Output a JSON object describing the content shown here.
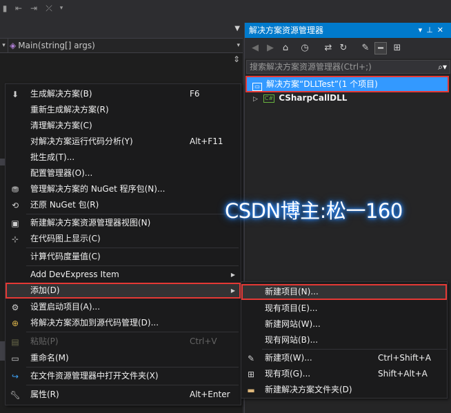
{
  "editor": {
    "nav_method": "Main(string[] args)"
  },
  "solution_explorer": {
    "title": "解决方案资源管理器",
    "title_buttons": [
      "▾",
      "⊥",
      "✕"
    ],
    "search_placeholder": "搜索解决方案资源管理器(Ctrl+;)",
    "solution_label": "解决方案“DLLTest”(1 个项目)",
    "project_label": "CSharpCallDLL"
  },
  "context_menu": {
    "items": [
      {
        "icon": "build-icon",
        "label": "生成解决方案(B)",
        "shortcut": "F6"
      },
      {
        "icon": "",
        "label": "重新生成解决方案(R)",
        "shortcut": ""
      },
      {
        "icon": "",
        "label": "清理解决方案(C)",
        "shortcut": ""
      },
      {
        "icon": "",
        "label": "对解决方案运行代码分析(Y)",
        "shortcut": "Alt+F11"
      },
      {
        "icon": "",
        "label": "批生成(T)...",
        "shortcut": ""
      },
      {
        "icon": "",
        "label": "配置管理器(O)...",
        "shortcut": ""
      },
      {
        "icon": "nuget-icon",
        "label": "管理解决方案的 NuGet 程序包(N)...",
        "shortcut": ""
      },
      {
        "icon": "restore-icon",
        "label": "还原 NuGet 包(R)",
        "shortcut": ""
      },
      {
        "icon": "new-view-icon",
        "label": "新建解决方案资源管理器视图(N)",
        "shortcut": ""
      },
      {
        "icon": "code-map-icon",
        "label": "在代码图上显示(C)",
        "shortcut": ""
      },
      {
        "icon": "",
        "label": "计算代码度量值(C)",
        "shortcut": ""
      },
      {
        "icon": "",
        "label": "Add DevExpress Item",
        "shortcut": ""
      },
      {
        "icon": "",
        "label": "添加(D)",
        "shortcut": ""
      },
      {
        "icon": "gear-icon",
        "label": "设置启动项目(A)...",
        "shortcut": ""
      },
      {
        "icon": "source-control-icon",
        "label": "将解决方案添加到源代码管理(D)...",
        "shortcut": ""
      },
      {
        "icon": "paste-icon",
        "label": "粘贴(P)",
        "shortcut": "Ctrl+V"
      },
      {
        "icon": "rename-icon",
        "label": "重命名(M)",
        "shortcut": ""
      },
      {
        "icon": "open-folder-icon",
        "label": "在文件资源管理器中打开文件夹(X)",
        "shortcut": ""
      },
      {
        "icon": "wrench-icon",
        "label": "属性(R)",
        "shortcut": "Alt+Enter"
      }
    ]
  },
  "submenu": {
    "items": [
      {
        "icon": "",
        "label": "新建项目(N)...",
        "shortcut": ""
      },
      {
        "icon": "",
        "label": "现有项目(E)...",
        "shortcut": ""
      },
      {
        "icon": "",
        "label": "新建网站(W)...",
        "shortcut": ""
      },
      {
        "icon": "",
        "label": "现有网站(B)...",
        "shortcut": ""
      },
      {
        "icon": "new-item-icon",
        "label": "新建项(W)...",
        "shortcut": "Ctrl+Shift+A"
      },
      {
        "icon": "existing-item-icon",
        "label": "现有项(G)...",
        "shortcut": "Shift+Alt+A"
      },
      {
        "icon": "new-folder-icon",
        "label": "新建解决方案文件夹(D)",
        "shortcut": ""
      }
    ]
  },
  "watermark": "CSDN博主:松一160",
  "colors": {
    "accent": "#007acc",
    "selection": "#3399ff",
    "highlight_border": "#e53935"
  }
}
